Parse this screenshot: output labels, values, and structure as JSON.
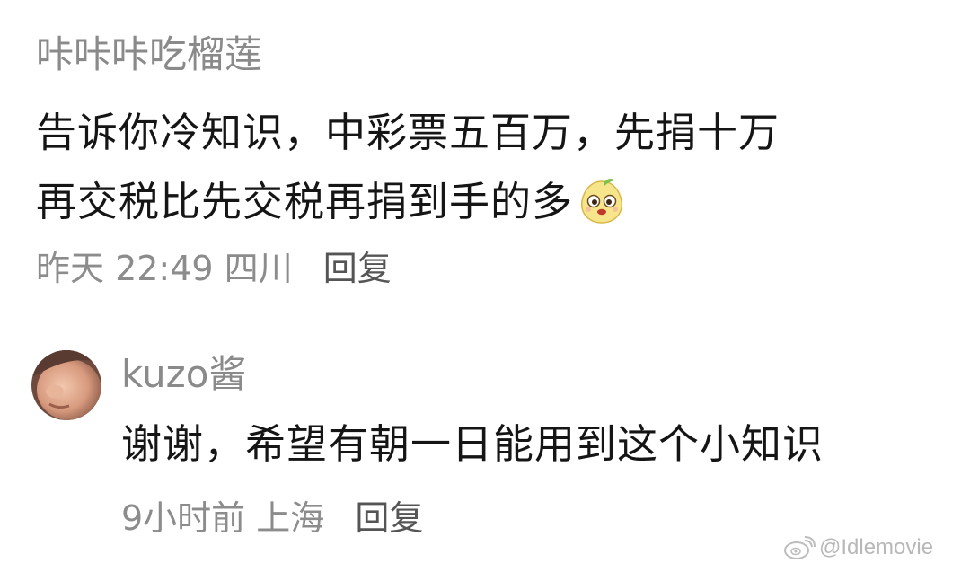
{
  "comment1": {
    "username": "咔咔咔吃榴莲",
    "text_line1": "告诉你冷知识，中彩票五百万，先捐十万",
    "text_line2": "再交税比先交税再捐到手的多",
    "emoji_icon": "pear-face-emoji",
    "time": "昨天 22:49",
    "location": "四川",
    "reply_label": "回复"
  },
  "comment2": {
    "username": "kuzo酱",
    "text": "谢谢，希望有朝一日能用到这个小知识",
    "time": "9小时前",
    "location": "上海",
    "reply_label": "回复"
  },
  "watermark": {
    "icon": "weibo-logo-icon",
    "text": "@Idlemovie"
  },
  "colors": {
    "username": "#8a8a8a",
    "text": "#151515",
    "meta": "#8c8c8c",
    "reply": "#555555",
    "watermark": "#b8b8b8"
  }
}
